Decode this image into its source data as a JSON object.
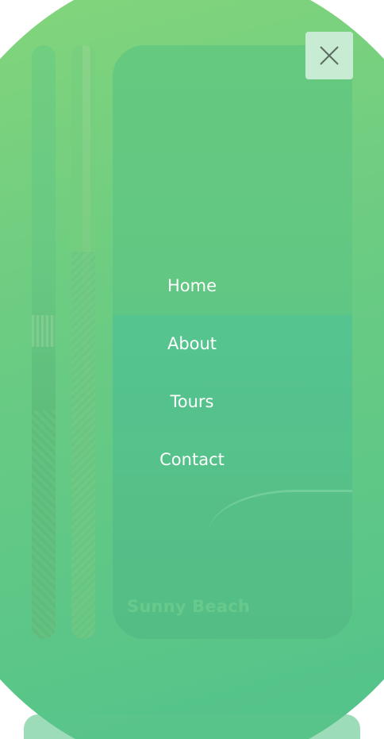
{
  "menu": {
    "items": [
      {
        "label": "Home"
      },
      {
        "label": "About"
      },
      {
        "label": "Tours"
      },
      {
        "label": "Contact"
      }
    ]
  },
  "gallery": {
    "card_title": "Sunny Beach"
  },
  "close_button": {
    "icon": "close-icon"
  },
  "colors": {
    "overlay_top": "#86d67a",
    "overlay_bottom": "#4fc28c",
    "close_bg": "#c8ecd3",
    "menu_text": "#ffffff"
  }
}
